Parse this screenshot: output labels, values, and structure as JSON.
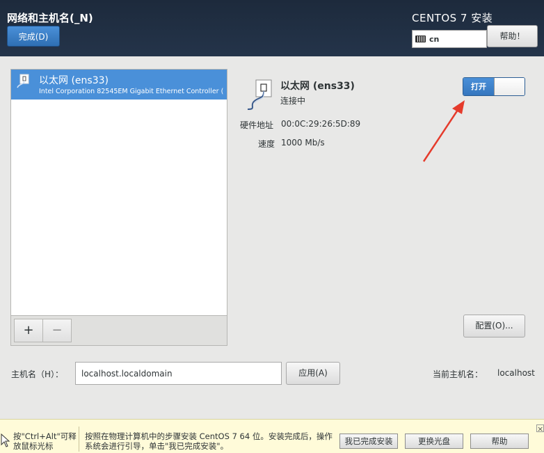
{
  "header": {
    "title": "网络和主机名(_N)",
    "done_label": "完成(D)",
    "install_title": "CENTOS 7 安装",
    "keyboard_layout": "cn",
    "help_label": "帮助！"
  },
  "device_list": {
    "items": [
      {
        "name": "以太网 (ens33)",
        "description": "Intel Corporation 82545EM Gigabit Ethernet Controller ("
      }
    ],
    "add_label": "+",
    "remove_label": "−"
  },
  "device": {
    "name": "以太网 (ens33)",
    "status": "连接中",
    "hw_label": "硬件地址",
    "hw_value": "00:0C:29:26:5D:89",
    "speed_label": "速度",
    "speed_value": "1000 Mb/s",
    "switch_label": "打开",
    "switch_on": true,
    "config_label": "配置(O)..."
  },
  "hostname": {
    "label": "主机名（H）：",
    "value": "localhost.localdomain",
    "apply_label": "应用(A)",
    "current_label": "当前主机名：",
    "current_value": "localhost"
  },
  "vm_bar": {
    "hint_release": "按\"Ctrl+Alt\"可释放鼠标光标",
    "hint_install": "按照在物理计算机中的步骤安装 CentOS 7 64 位。安装完成后，操作系统会进行引导，单击\"我已完成安装\"。",
    "finished_label": "我已完成安装",
    "change_disc_label": "更换光盘",
    "help_label": "帮助"
  },
  "colors": {
    "header_bg": "#1d2a3c",
    "accent": "#4a90d9",
    "annotation_arrow": "#e53b2c"
  }
}
